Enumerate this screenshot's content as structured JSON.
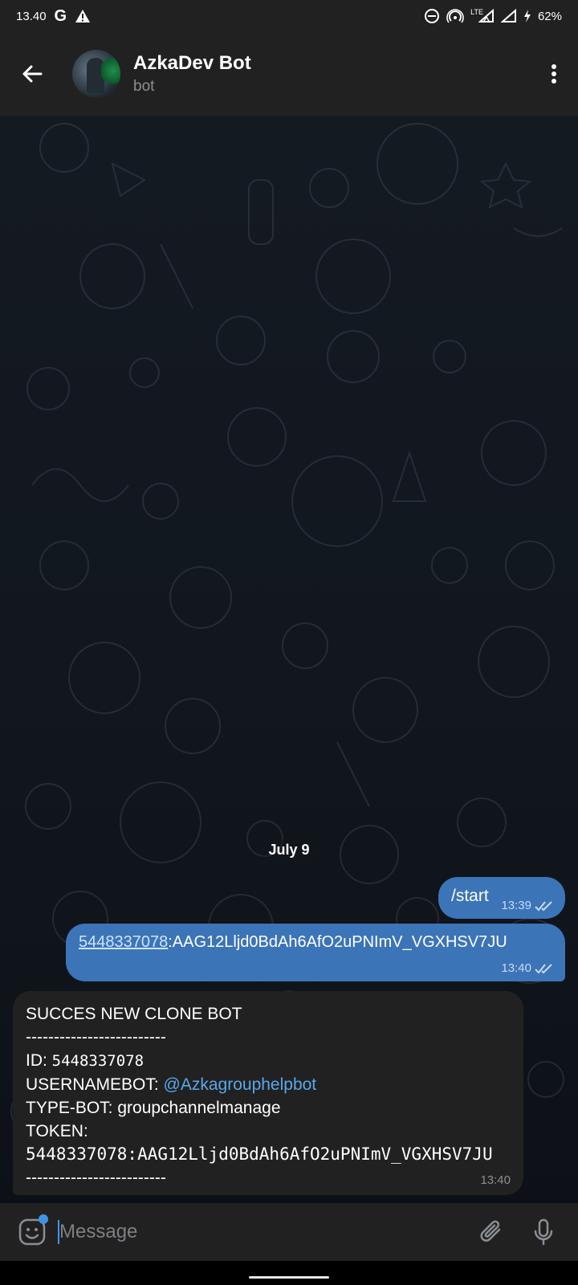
{
  "status_bar": {
    "time": "13.40",
    "network": "LTE",
    "battery": "62%",
    "icons": [
      "google-icon",
      "warning-icon",
      "dnd-icon",
      "hotspot-icon",
      "signal-icon",
      "signal-icon",
      "battery-charging-icon"
    ]
  },
  "header": {
    "title": "AzkaDev Bot",
    "subtitle": "bot"
  },
  "chat": {
    "date_label": "July 9",
    "messages": [
      {
        "direction": "out",
        "text": "/start",
        "time": "13:39"
      },
      {
        "direction": "out",
        "link": "5448337078",
        "text": ":AAG12Lljd0BdAh6AfO2uPNImV_VGXHSV7JU",
        "time": "13:40"
      },
      {
        "direction": "in",
        "lines": {
          "title": "SUCCES NEW CLONE BOT",
          "divider": "-------------------------",
          "id_label": "ID: ",
          "id_value": "5448337078",
          "username_label": "USERNAMEBOT: ",
          "username_value": "@Azkagrouphelpbot",
          "type_label": "TYPE-BOT: groupchannelmanage",
          "token_label": "TOKEN:",
          "token_value": "5448337078:AAG12Lljd0BdAh6AfO2uPNImV_VGXHSV7JU",
          "divider_end": "-------------------------"
        },
        "time": "13:40"
      }
    ]
  },
  "input": {
    "placeholder": "Message"
  },
  "colors": {
    "bar_bg": "#212121",
    "outgoing_bubble": "#3c74b8",
    "incoming_bubble": "#212121",
    "accent": "#3e93e8",
    "mention": "#5aa7ea"
  }
}
